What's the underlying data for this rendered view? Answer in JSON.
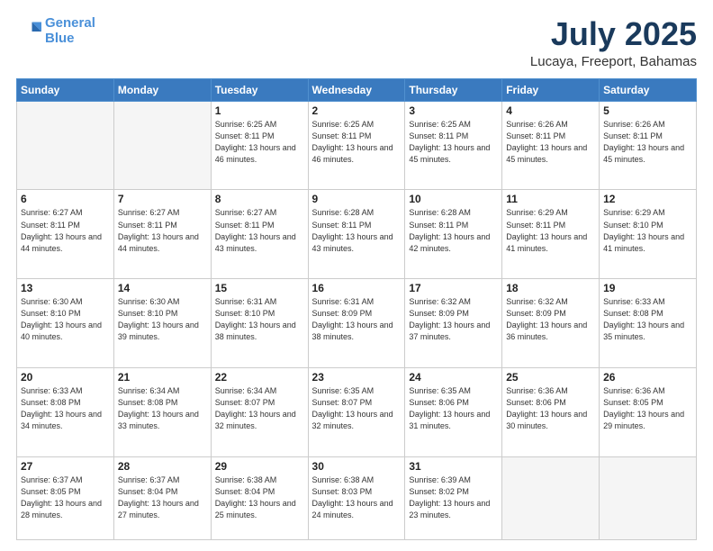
{
  "header": {
    "logo_line1": "General",
    "logo_line2": "Blue",
    "title": "July 2025",
    "subtitle": "Lucaya, Freeport, Bahamas"
  },
  "days_of_week": [
    "Sunday",
    "Monday",
    "Tuesday",
    "Wednesday",
    "Thursday",
    "Friday",
    "Saturday"
  ],
  "weeks": [
    [
      {
        "day": "",
        "info": ""
      },
      {
        "day": "",
        "info": ""
      },
      {
        "day": "1",
        "info": "Sunrise: 6:25 AM\nSunset: 8:11 PM\nDaylight: 13 hours and 46 minutes."
      },
      {
        "day": "2",
        "info": "Sunrise: 6:25 AM\nSunset: 8:11 PM\nDaylight: 13 hours and 46 minutes."
      },
      {
        "day": "3",
        "info": "Sunrise: 6:25 AM\nSunset: 8:11 PM\nDaylight: 13 hours and 45 minutes."
      },
      {
        "day": "4",
        "info": "Sunrise: 6:26 AM\nSunset: 8:11 PM\nDaylight: 13 hours and 45 minutes."
      },
      {
        "day": "5",
        "info": "Sunrise: 6:26 AM\nSunset: 8:11 PM\nDaylight: 13 hours and 45 minutes."
      }
    ],
    [
      {
        "day": "6",
        "info": "Sunrise: 6:27 AM\nSunset: 8:11 PM\nDaylight: 13 hours and 44 minutes."
      },
      {
        "day": "7",
        "info": "Sunrise: 6:27 AM\nSunset: 8:11 PM\nDaylight: 13 hours and 44 minutes."
      },
      {
        "day": "8",
        "info": "Sunrise: 6:27 AM\nSunset: 8:11 PM\nDaylight: 13 hours and 43 minutes."
      },
      {
        "day": "9",
        "info": "Sunrise: 6:28 AM\nSunset: 8:11 PM\nDaylight: 13 hours and 43 minutes."
      },
      {
        "day": "10",
        "info": "Sunrise: 6:28 AM\nSunset: 8:11 PM\nDaylight: 13 hours and 42 minutes."
      },
      {
        "day": "11",
        "info": "Sunrise: 6:29 AM\nSunset: 8:11 PM\nDaylight: 13 hours and 41 minutes."
      },
      {
        "day": "12",
        "info": "Sunrise: 6:29 AM\nSunset: 8:10 PM\nDaylight: 13 hours and 41 minutes."
      }
    ],
    [
      {
        "day": "13",
        "info": "Sunrise: 6:30 AM\nSunset: 8:10 PM\nDaylight: 13 hours and 40 minutes."
      },
      {
        "day": "14",
        "info": "Sunrise: 6:30 AM\nSunset: 8:10 PM\nDaylight: 13 hours and 39 minutes."
      },
      {
        "day": "15",
        "info": "Sunrise: 6:31 AM\nSunset: 8:10 PM\nDaylight: 13 hours and 38 minutes."
      },
      {
        "day": "16",
        "info": "Sunrise: 6:31 AM\nSunset: 8:09 PM\nDaylight: 13 hours and 38 minutes."
      },
      {
        "day": "17",
        "info": "Sunrise: 6:32 AM\nSunset: 8:09 PM\nDaylight: 13 hours and 37 minutes."
      },
      {
        "day": "18",
        "info": "Sunrise: 6:32 AM\nSunset: 8:09 PM\nDaylight: 13 hours and 36 minutes."
      },
      {
        "day": "19",
        "info": "Sunrise: 6:33 AM\nSunset: 8:08 PM\nDaylight: 13 hours and 35 minutes."
      }
    ],
    [
      {
        "day": "20",
        "info": "Sunrise: 6:33 AM\nSunset: 8:08 PM\nDaylight: 13 hours and 34 minutes."
      },
      {
        "day": "21",
        "info": "Sunrise: 6:34 AM\nSunset: 8:08 PM\nDaylight: 13 hours and 33 minutes."
      },
      {
        "day": "22",
        "info": "Sunrise: 6:34 AM\nSunset: 8:07 PM\nDaylight: 13 hours and 32 minutes."
      },
      {
        "day": "23",
        "info": "Sunrise: 6:35 AM\nSunset: 8:07 PM\nDaylight: 13 hours and 32 minutes."
      },
      {
        "day": "24",
        "info": "Sunrise: 6:35 AM\nSunset: 8:06 PM\nDaylight: 13 hours and 31 minutes."
      },
      {
        "day": "25",
        "info": "Sunrise: 6:36 AM\nSunset: 8:06 PM\nDaylight: 13 hours and 30 minutes."
      },
      {
        "day": "26",
        "info": "Sunrise: 6:36 AM\nSunset: 8:05 PM\nDaylight: 13 hours and 29 minutes."
      }
    ],
    [
      {
        "day": "27",
        "info": "Sunrise: 6:37 AM\nSunset: 8:05 PM\nDaylight: 13 hours and 28 minutes."
      },
      {
        "day": "28",
        "info": "Sunrise: 6:37 AM\nSunset: 8:04 PM\nDaylight: 13 hours and 27 minutes."
      },
      {
        "day": "29",
        "info": "Sunrise: 6:38 AM\nSunset: 8:04 PM\nDaylight: 13 hours and 25 minutes."
      },
      {
        "day": "30",
        "info": "Sunrise: 6:38 AM\nSunset: 8:03 PM\nDaylight: 13 hours and 24 minutes."
      },
      {
        "day": "31",
        "info": "Sunrise: 6:39 AM\nSunset: 8:02 PM\nDaylight: 13 hours and 23 minutes."
      },
      {
        "day": "",
        "info": ""
      },
      {
        "day": "",
        "info": ""
      }
    ]
  ]
}
